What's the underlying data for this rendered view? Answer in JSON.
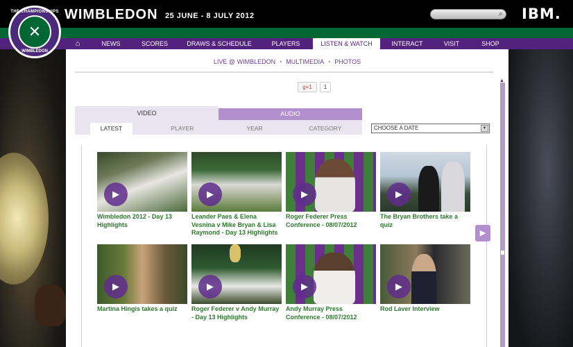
{
  "header": {
    "logo_top": "THE CHAMPIONSHIPS",
    "logo_bottom": "WIMBLEDON",
    "brand": "WIMBLEDON",
    "dates": "25 JUNE - 8 JULY 2012",
    "sponsor": "IBM."
  },
  "nav": {
    "items": [
      {
        "label": "NEWS"
      },
      {
        "label": "SCORES"
      },
      {
        "label": "DRAWS & SCHEDULE"
      },
      {
        "label": "PLAYERS"
      },
      {
        "label": "LISTEN & WATCH"
      },
      {
        "label": "INTERACT"
      },
      {
        "label": "VISIT"
      },
      {
        "label": "SHOP"
      }
    ],
    "active": "LISTEN & WATCH"
  },
  "sub_links": [
    "LIVE @ WIMBLEDON",
    "MULTIMEDIA",
    "PHOTOS"
  ],
  "social": {
    "gplus_label": "+1",
    "gplus_count": "1"
  },
  "tabs": {
    "video": "VIDEO",
    "audio": "AUDIO"
  },
  "filters": [
    "LATEST",
    "PLAYER",
    "YEAR",
    "CATEGORY"
  ],
  "date_select": {
    "value": "CHOOSE A DATE"
  },
  "videos": [
    {
      "title": "Wimbledon 2012 - Day 13 Highlights"
    },
    {
      "title": "Leander Paes & Elena Vesnina v Mike Bryan & Lisa Raymond - Day 13 Highlights"
    },
    {
      "title": "Roger Federer Press Conference - 08/07/2012"
    },
    {
      "title": "The Bryan Brothers take a quiz"
    },
    {
      "title": "Martina Hingis takes a quiz"
    },
    {
      "title": "Roger Federer v Andy Murray - Day 13 Highlights"
    },
    {
      "title": "Andy Murray Press Conference - 08/07/2012"
    },
    {
      "title": "Rod Laver Interview"
    }
  ],
  "colors": {
    "purple": "#53227f",
    "green": "#006633",
    "light_purple": "#b38fd0",
    "title_green": "#2b7a2b"
  }
}
